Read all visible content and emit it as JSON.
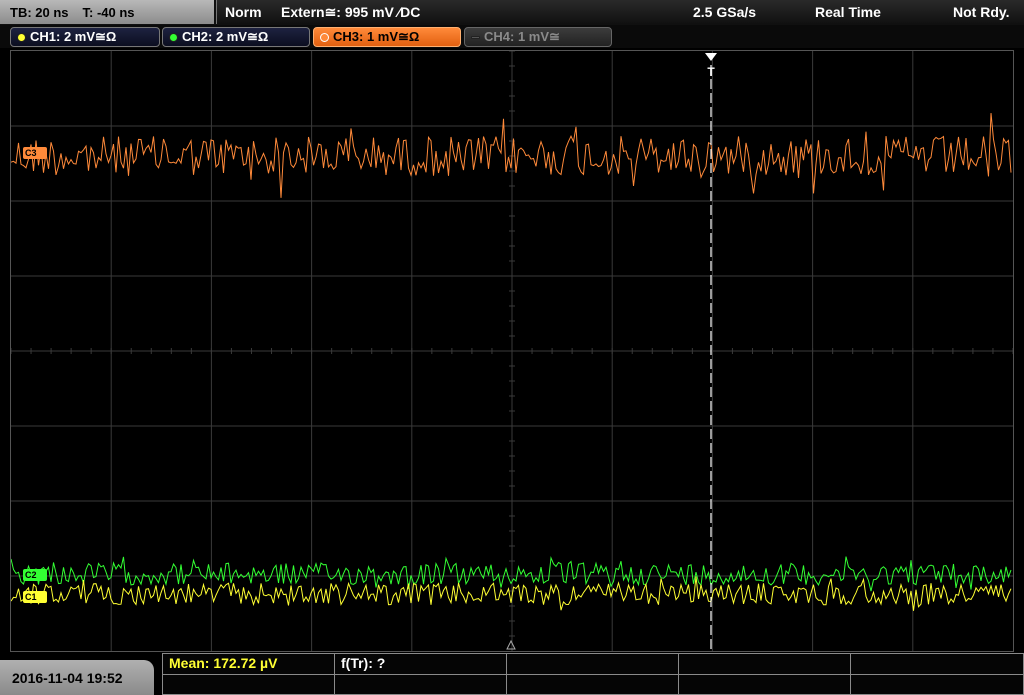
{
  "topbar": {
    "timebase": "TB: 20 ns",
    "trigger_time": "T: -40 ns",
    "acq_mode": "Norm",
    "trigger": "Extern≅: 995 mV ∕DC",
    "sample_rate": "2.5 GSa/s",
    "mode": "Real Time",
    "status": "Not Rdy."
  },
  "channels": [
    {
      "label": "CH1: 2 mV≅Ω",
      "color": "#ffff33",
      "state": "on"
    },
    {
      "label": "CH2: 2 mV≅Ω",
      "color": "#33ff33",
      "state": "on"
    },
    {
      "label": "CH3: 1 mV≅Ω",
      "color": "#ff8a3a",
      "state": "active"
    },
    {
      "label": "CH4: 1 mV≅",
      "color": "#555555",
      "state": "off"
    }
  ],
  "markers": {
    "ch3": "C3",
    "ch2": "C2",
    "ch1": "C1",
    "trigger": "T"
  },
  "colors": {
    "ch1": "#ffff33",
    "ch2": "#33ff33",
    "ch3": "#ff8a3a",
    "grid": "#3a3a3a"
  },
  "bottom": {
    "datetime": "2016-11-04 19:52",
    "mean_label": "Mean: 172.72 µV",
    "freq_label": "f(Tr): ?"
  }
}
